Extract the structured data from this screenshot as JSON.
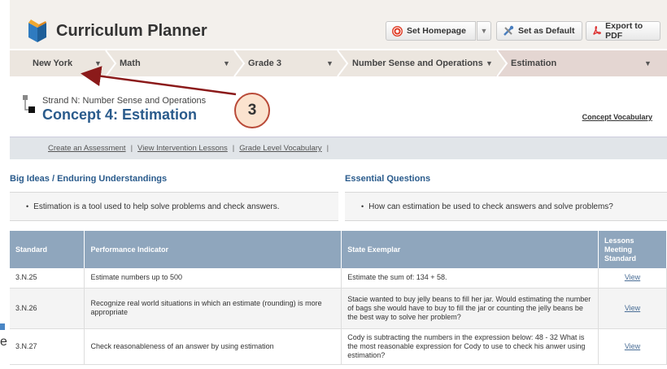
{
  "app": {
    "title": "Curriculum Planner"
  },
  "header_buttons": {
    "set_homepage": "Set Homepage",
    "set_default": "Set as Default",
    "export_pdf": "Export to PDF"
  },
  "breadcrumb": [
    "New York",
    "Math",
    "Grade 3",
    "Number Sense and Operations",
    "Estimation"
  ],
  "annotation": {
    "number": "3"
  },
  "concept": {
    "strand": "Strand N: Number Sense and Operations",
    "title": "Concept 4: Estimation",
    "vocab_link": "Concept Vocabulary"
  },
  "links": [
    "Create an Assessment",
    "View Intervention Lessons",
    "Grade Level Vocabulary"
  ],
  "big_ideas": {
    "heading": "Big Ideas / Enduring Understandings",
    "item": "Estimation is a tool used to help solve problems and check answers."
  },
  "essential": {
    "heading": "Essential Questions",
    "item": "How can estimation be used to check answers and solve problems?"
  },
  "table": {
    "headers": [
      "Standard",
      "Performance Indicator",
      "State Exemplar",
      "Lessons Meeting Standard"
    ],
    "rows": [
      {
        "standard": "3.N.25",
        "indicator": "Estimate numbers up to 500",
        "exemplar": "Estimate the sum of:   134 + 58.",
        "link": "View"
      },
      {
        "standard": "3.N.26",
        "indicator": "Recognize real world situations in which an estimate (rounding) is more appropriate",
        "exemplar": "Stacie wanted to buy jelly beans to fill her jar. Would estimating the number of bags she would have to buy to fill the jar or counting the jelly beans be the best way to solve her problem?",
        "link": "View"
      },
      {
        "standard": "3.N.27",
        "indicator": "Check reasonableness of an answer by using estimation",
        "exemplar": "Cody is subtracting the numbers in the expression below:   48 - 32 What is the most reasonable expression for Cody to use to check his anwer using estimation?",
        "link": "View"
      }
    ]
  },
  "edge_fragment": "e",
  "colors": {
    "accent": "#2a5b8c",
    "badge_border": "#b94a38",
    "arrow": "#8b1a1a"
  }
}
